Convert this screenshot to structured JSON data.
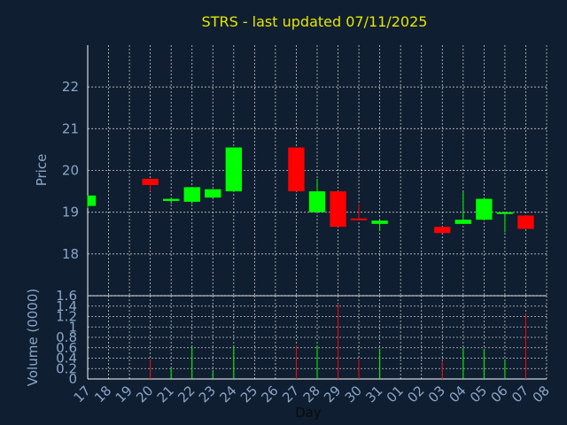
{
  "chart_data": [
    {
      "type": "candlestick",
      "title": "STRS - last updated 07/11/2025",
      "ylabel": "Price",
      "ylim": [
        17.0,
        23.0
      ],
      "yticks": [
        18,
        19,
        20,
        21,
        22
      ],
      "grid": true,
      "x_tick_labels": [
        "17",
        "18",
        "19",
        "20",
        "21",
        "22",
        "23",
        "24",
        "25",
        "26",
        "27",
        "28",
        "29",
        "30",
        "31",
        "01",
        "02",
        "03",
        "04",
        "05",
        "06",
        "07",
        "08"
      ],
      "candles": [
        {
          "day": "17",
          "open": 19.15,
          "high": 19.4,
          "low": 19.1,
          "close": 19.4
        },
        {
          "day": "20",
          "open": 19.8,
          "high": 19.8,
          "low": 19.5,
          "close": 19.65
        },
        {
          "day": "21",
          "open": 19.27,
          "high": 19.3,
          "low": 19.2,
          "close": 19.32
        },
        {
          "day": "22",
          "open": 19.25,
          "high": 19.6,
          "low": 19.2,
          "close": 19.6
        },
        {
          "day": "23",
          "open": 19.35,
          "high": 19.55,
          "low": 19.35,
          "close": 19.55
        },
        {
          "day": "24",
          "open": 19.5,
          "high": 20.55,
          "low": 19.5,
          "close": 20.55
        },
        {
          "day": "27",
          "open": 20.55,
          "high": 20.55,
          "low": 19.5,
          "close": 19.5
        },
        {
          "day": "28",
          "open": 19.0,
          "high": 19.8,
          "low": 19.0,
          "close": 19.5
        },
        {
          "day": "29",
          "open": 19.5,
          "high": 19.5,
          "low": 18.65,
          "close": 18.65
        },
        {
          "day": "30",
          "open": 18.85,
          "high": 19.2,
          "low": 18.8,
          "close": 18.82
        },
        {
          "day": "31",
          "open": 18.72,
          "high": 18.8,
          "low": 18.55,
          "close": 18.8
        },
        {
          "day": "03",
          "open": 18.65,
          "high": 18.65,
          "low": 18.5,
          "close": 18.5
        },
        {
          "day": "04",
          "open": 18.72,
          "high": 19.5,
          "low": 18.72,
          "close": 18.82
        },
        {
          "day": "05",
          "open": 18.82,
          "high": 19.35,
          "low": 18.82,
          "close": 19.32
        },
        {
          "day": "06",
          "open": 18.97,
          "high": 19.0,
          "low": 18.52,
          "close": 19.0
        },
        {
          "day": "07",
          "open": 18.92,
          "high": 18.92,
          "low": 18.6,
          "close": 18.6
        }
      ]
    },
    {
      "type": "bar",
      "ylabel": "Volume (0000)",
      "xlabel": "Day",
      "ylim": [
        0,
        1.6
      ],
      "yticks": [
        "0",
        "0.2",
        "0.4",
        "0.6",
        "0.8",
        "1",
        "1.2",
        "1.4",
        "1.6"
      ],
      "ytick_values": [
        0,
        0.2,
        0.4,
        0.6,
        0.8,
        1.0,
        1.2,
        1.4,
        1.6
      ],
      "grid": true,
      "x_tick_labels": [
        "17",
        "18",
        "19",
        "20",
        "21",
        "22",
        "23",
        "24",
        "25",
        "26",
        "27",
        "28",
        "29",
        "30",
        "31",
        "01",
        "02",
        "03",
        "04",
        "05",
        "06",
        "07",
        "08"
      ],
      "bars": [
        {
          "day": "20",
          "value": 0.38,
          "direction": "down"
        },
        {
          "day": "21",
          "value": 0.2,
          "direction": "up"
        },
        {
          "day": "22",
          "value": 0.62,
          "direction": "up"
        },
        {
          "day": "23",
          "value": 0.15,
          "direction": "up"
        },
        {
          "day": "24",
          "value": 0.62,
          "direction": "up"
        },
        {
          "day": "27",
          "value": 0.65,
          "direction": "down"
        },
        {
          "day": "28",
          "value": 0.65,
          "direction": "up"
        },
        {
          "day": "29",
          "value": 1.45,
          "direction": "down"
        },
        {
          "day": "30",
          "value": 0.38,
          "direction": "down"
        },
        {
          "day": "31",
          "value": 0.58,
          "direction": "up"
        },
        {
          "day": "03",
          "value": 0.35,
          "direction": "down"
        },
        {
          "day": "04",
          "value": 0.6,
          "direction": "up"
        },
        {
          "day": "05",
          "value": 0.58,
          "direction": "up"
        },
        {
          "day": "06",
          "value": 0.38,
          "direction": "up"
        },
        {
          "day": "07",
          "value": 1.25,
          "direction": "down"
        }
      ]
    }
  ],
  "colors": {
    "background": "#0f1e30",
    "plot_background": "#0f1e30",
    "grid": "#c8c8c8",
    "axis": "#ffffff",
    "title": "#e6e600",
    "text": "#8aa6c8",
    "up": "#00ff00",
    "down": "#ff0000",
    "xlabel": "#0b0b0b"
  }
}
